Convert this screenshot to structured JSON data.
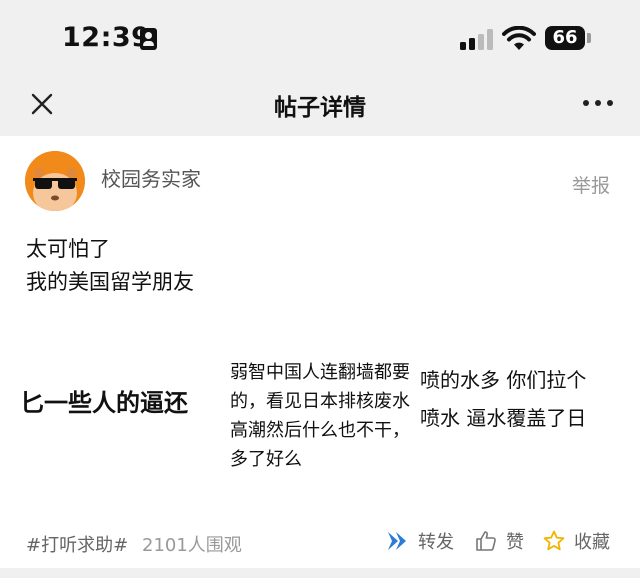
{
  "status_bar": {
    "time": "12:39",
    "battery": "66",
    "icons": [
      "id-card-icon",
      "cellular-signal-icon",
      "wifi-icon",
      "battery-icon"
    ]
  },
  "nav": {
    "title": "帖子详情",
    "left_icon": "close-icon",
    "right_icon": "more-icon"
  },
  "post": {
    "author": "校园务实家",
    "report_label": "举报",
    "text_lines": [
      "太可怕了",
      "我的美国留学朋友"
    ],
    "image": {
      "left_text": "匕一些人的逼还",
      "overlay_lines": [
        "弱智中国人连翻墙都要",
        "的，看见日本排核废水",
        "高潮然后什么也不干，",
        "多了好么"
      ],
      "right_lines": [
        "喷的水多 你们拉个",
        "喷水 逼水覆盖了日"
      ]
    }
  },
  "footer": {
    "hashtag": "#打听求助#",
    "views": "2101人围观",
    "share_label": "转发",
    "like_label": "赞",
    "favorite_label": "收藏"
  },
  "colors": {
    "chrome_background": "#f0f0f0",
    "avatar_orange": "#f28a1b",
    "share_blue": "#2e7bd6",
    "star_yellow": "#f0b400"
  }
}
